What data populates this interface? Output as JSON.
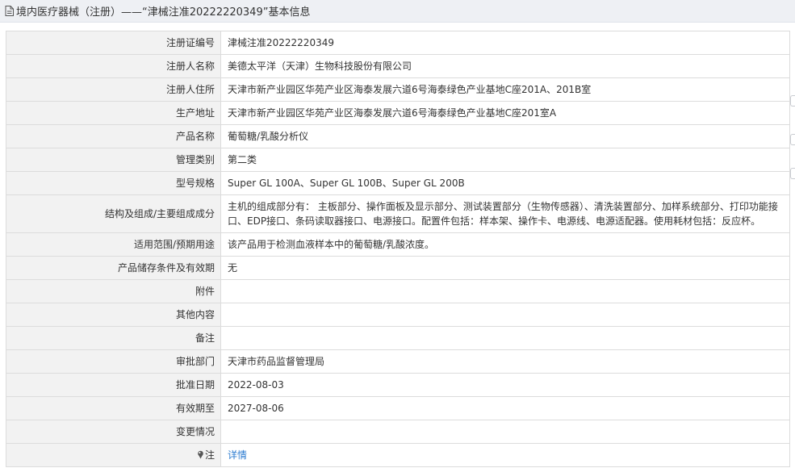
{
  "header": {
    "title": "境内医疗器械（注册）——“津械注准20222220349”基本信息",
    "icon": "document-icon"
  },
  "rows": [
    {
      "label": "注册证编号",
      "value": "津械注准20222220349"
    },
    {
      "label": "注册人名称",
      "value": "美德太平洋（天津）生物科技股份有限公司"
    },
    {
      "label": "注册人住所",
      "value": "天津市新产业园区华苑产业区海泰发展六道6号海泰绿色产业基地C座201A、201B室"
    },
    {
      "label": "生产地址",
      "value": "天津市新产业园区华苑产业区海泰发展六道6号海泰绿色产业基地C座201室A"
    },
    {
      "label": "产品名称",
      "value": "葡萄糖/乳酸分析仪"
    },
    {
      "label": "管理类别",
      "value": "第二类"
    },
    {
      "label": "型号规格",
      "value": "Super GL 100A、Super GL 100B、Super GL 200B"
    },
    {
      "label": "结构及组成/主要组成成分",
      "value": "主机的组成部分有： 主板部分、操作面板及显示部分、测试装置部分（生物传感器）、清洗装置部分、加样系统部分、打印功能接口、EDP接口、条码读取器接口、电源接口。配置件包括：样本架、操作卡、电源线、电源适配器。使用耗材包括：反应杯。"
    },
    {
      "label": "适用范围/预期用途",
      "value": "该产品用于检测血液样本中的葡萄糖/乳酸浓度。"
    },
    {
      "label": "产品储存条件及有效期",
      "value": "无"
    },
    {
      "label": "附件",
      "value": ""
    },
    {
      "label": "其他内容",
      "value": ""
    },
    {
      "label": "备注",
      "value": ""
    },
    {
      "label": "审批部门",
      "value": "天津市药品监督管理局"
    },
    {
      "label": "批准日期",
      "value": "2022-08-03"
    },
    {
      "label": "有效期至",
      "value": "2027-08-06"
    },
    {
      "label": "变更情况",
      "value": ""
    }
  ],
  "note": {
    "label": "注",
    "link_text": "详情",
    "icon": "pin-icon"
  },
  "colors": {
    "link": "#2e7dd1",
    "label_bg": "#f2f2f2",
    "border": "#dcdcdc",
    "header_bg": "#eef0f4"
  }
}
